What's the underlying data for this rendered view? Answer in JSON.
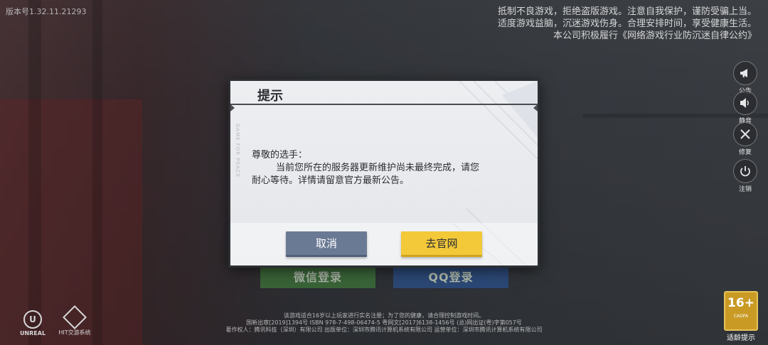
{
  "app": {
    "version": "版本号1.32.11.21293"
  },
  "health_notice": [
    "抵制不良游戏，拒绝盗版游戏。注意自我保护，谨防受骗上当。",
    "适度游戏益脑，沉迷游戏伤身。合理安排时间，享受健康生活。",
    "本公司积极履行《网络游戏行业防沉迷自律公约》"
  ],
  "side_buttons": [
    {
      "label": "公告",
      "icon": "megaphone-icon"
    },
    {
      "label": "静音",
      "icon": "speaker-icon"
    },
    {
      "label": "修复",
      "icon": "wrench-icon"
    },
    {
      "label": "注销",
      "icon": "power-icon"
    }
  ],
  "login": {
    "wechat_label": "微信登录",
    "qq_label": "QQ登录"
  },
  "dialog": {
    "title": "提示",
    "greeting": "尊敬的选手：",
    "message_line1": "当前您所在的服务器更新维护尚未最终完成，请您",
    "message_line2": "耐心等待。详情请留意官方最新公告。",
    "cancel_label": "取消",
    "official_label": "去官网",
    "deco_text": "GAME FOR PEACE"
  },
  "footer": {
    "line1": "该游戏适合16岁以上玩家进行实名注册；为了您的健康，请合理控制游戏时间。",
    "line2": "国新出审[2019]1394号  ISBN 978-7-498-06474-5  粤网文[2017]6138-1456号 (总)网出证(粤)字第057号",
    "line3": "著作权人：腾讯科技（深圳）有限公司  出版单位：深圳市腾讯计算机系统有限公司  运营单位：深圳市腾讯计算机系统有限公司"
  },
  "logos": {
    "unreal": "UNREAL",
    "tsc": "HIT交游系统"
  },
  "age_rating": {
    "value": "16+",
    "sub": "CADPA",
    "label": "适龄提示"
  }
}
